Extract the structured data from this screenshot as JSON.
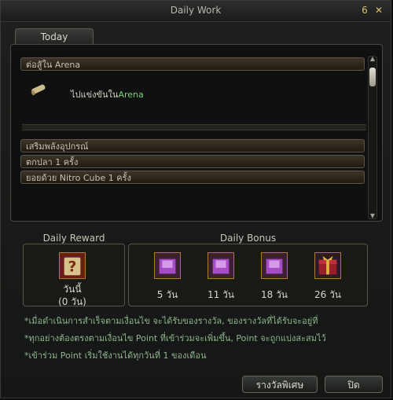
{
  "window": {
    "title": "Daily Work"
  },
  "tabs": {
    "active": "Today"
  },
  "quests": {
    "arena_header": "ต่อสู้ใน Arena",
    "arena_text": "ไปแข่งขันใน",
    "arena_highlight": "Arena",
    "item2": "เสริมพลังอุปกรณ์",
    "item3": "ตกปลา 1 ครั้ง",
    "item4": "ยอยด้วย Nitro Cube 1 ครั้ง"
  },
  "daily_reward": {
    "title": "Daily Reward",
    "line1": "วันนี้",
    "line2": "(0 วัน)",
    "icon": "question-scroll-icon"
  },
  "daily_bonus": {
    "title": "Daily Bonus",
    "items": [
      {
        "label": "5  วัน",
        "icon": "purple-box-icon"
      },
      {
        "label": "11  วัน",
        "icon": "purple-box-icon"
      },
      {
        "label": "18  วัน",
        "icon": "purple-box-icon"
      },
      {
        "label": "26  วัน",
        "icon": "gift-box-icon"
      }
    ]
  },
  "info_lines": [
    "*เมื่อดำเนินการสำเร็จตามเงื่อนไข จะได้รับของรางวัล, ของรางวัลที่ได้รับจะอยู่ที่",
    "*ทุกอย่างต้องตรงตามเงื่อนไข Point ที่เข้าร่วมจะเพิ่มขึ้น, Point จะถูกแบ่งสะสมไว้",
    "*เข้าร่วม Point เริ่มใช้งานได้ทุกวันที่ 1 ของเดือน"
  ],
  "buttons": {
    "special": "รางวัลพิเศษ",
    "close": "ปิด"
  },
  "colors": {
    "highlight_green": "#7fcf7c",
    "info_green": "#8fb58c",
    "gold_border": "#ae7a2e"
  }
}
